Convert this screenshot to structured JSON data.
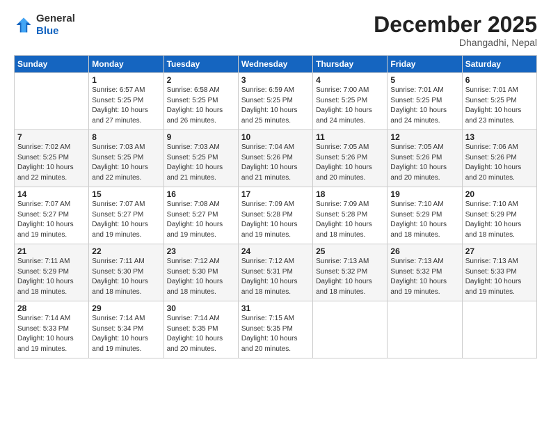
{
  "header": {
    "logo_general": "General",
    "logo_blue": "Blue",
    "month_title": "December 2025",
    "location": "Dhangadhi, Nepal"
  },
  "weekdays": [
    "Sunday",
    "Monday",
    "Tuesday",
    "Wednesday",
    "Thursday",
    "Friday",
    "Saturday"
  ],
  "weeks": [
    [
      {
        "day": "",
        "info": ""
      },
      {
        "day": "1",
        "info": "Sunrise: 6:57 AM\nSunset: 5:25 PM\nDaylight: 10 hours\nand 27 minutes."
      },
      {
        "day": "2",
        "info": "Sunrise: 6:58 AM\nSunset: 5:25 PM\nDaylight: 10 hours\nand 26 minutes."
      },
      {
        "day": "3",
        "info": "Sunrise: 6:59 AM\nSunset: 5:25 PM\nDaylight: 10 hours\nand 25 minutes."
      },
      {
        "day": "4",
        "info": "Sunrise: 7:00 AM\nSunset: 5:25 PM\nDaylight: 10 hours\nand 24 minutes."
      },
      {
        "day": "5",
        "info": "Sunrise: 7:01 AM\nSunset: 5:25 PM\nDaylight: 10 hours\nand 24 minutes."
      },
      {
        "day": "6",
        "info": "Sunrise: 7:01 AM\nSunset: 5:25 PM\nDaylight: 10 hours\nand 23 minutes."
      }
    ],
    [
      {
        "day": "7",
        "info": "Sunrise: 7:02 AM\nSunset: 5:25 PM\nDaylight: 10 hours\nand 22 minutes."
      },
      {
        "day": "8",
        "info": "Sunrise: 7:03 AM\nSunset: 5:25 PM\nDaylight: 10 hours\nand 22 minutes."
      },
      {
        "day": "9",
        "info": "Sunrise: 7:03 AM\nSunset: 5:25 PM\nDaylight: 10 hours\nand 21 minutes."
      },
      {
        "day": "10",
        "info": "Sunrise: 7:04 AM\nSunset: 5:26 PM\nDaylight: 10 hours\nand 21 minutes."
      },
      {
        "day": "11",
        "info": "Sunrise: 7:05 AM\nSunset: 5:26 PM\nDaylight: 10 hours\nand 20 minutes."
      },
      {
        "day": "12",
        "info": "Sunrise: 7:05 AM\nSunset: 5:26 PM\nDaylight: 10 hours\nand 20 minutes."
      },
      {
        "day": "13",
        "info": "Sunrise: 7:06 AM\nSunset: 5:26 PM\nDaylight: 10 hours\nand 20 minutes."
      }
    ],
    [
      {
        "day": "14",
        "info": "Sunrise: 7:07 AM\nSunset: 5:27 PM\nDaylight: 10 hours\nand 19 minutes."
      },
      {
        "day": "15",
        "info": "Sunrise: 7:07 AM\nSunset: 5:27 PM\nDaylight: 10 hours\nand 19 minutes."
      },
      {
        "day": "16",
        "info": "Sunrise: 7:08 AM\nSunset: 5:27 PM\nDaylight: 10 hours\nand 19 minutes."
      },
      {
        "day": "17",
        "info": "Sunrise: 7:09 AM\nSunset: 5:28 PM\nDaylight: 10 hours\nand 19 minutes."
      },
      {
        "day": "18",
        "info": "Sunrise: 7:09 AM\nSunset: 5:28 PM\nDaylight: 10 hours\nand 18 minutes."
      },
      {
        "day": "19",
        "info": "Sunrise: 7:10 AM\nSunset: 5:29 PM\nDaylight: 10 hours\nand 18 minutes."
      },
      {
        "day": "20",
        "info": "Sunrise: 7:10 AM\nSunset: 5:29 PM\nDaylight: 10 hours\nand 18 minutes."
      }
    ],
    [
      {
        "day": "21",
        "info": "Sunrise: 7:11 AM\nSunset: 5:29 PM\nDaylight: 10 hours\nand 18 minutes."
      },
      {
        "day": "22",
        "info": "Sunrise: 7:11 AM\nSunset: 5:30 PM\nDaylight: 10 hours\nand 18 minutes."
      },
      {
        "day": "23",
        "info": "Sunrise: 7:12 AM\nSunset: 5:30 PM\nDaylight: 10 hours\nand 18 minutes."
      },
      {
        "day": "24",
        "info": "Sunrise: 7:12 AM\nSunset: 5:31 PM\nDaylight: 10 hours\nand 18 minutes."
      },
      {
        "day": "25",
        "info": "Sunrise: 7:13 AM\nSunset: 5:32 PM\nDaylight: 10 hours\nand 18 minutes."
      },
      {
        "day": "26",
        "info": "Sunrise: 7:13 AM\nSunset: 5:32 PM\nDaylight: 10 hours\nand 19 minutes."
      },
      {
        "day": "27",
        "info": "Sunrise: 7:13 AM\nSunset: 5:33 PM\nDaylight: 10 hours\nand 19 minutes."
      }
    ],
    [
      {
        "day": "28",
        "info": "Sunrise: 7:14 AM\nSunset: 5:33 PM\nDaylight: 10 hours\nand 19 minutes."
      },
      {
        "day": "29",
        "info": "Sunrise: 7:14 AM\nSunset: 5:34 PM\nDaylight: 10 hours\nand 19 minutes."
      },
      {
        "day": "30",
        "info": "Sunrise: 7:14 AM\nSunset: 5:35 PM\nDaylight: 10 hours\nand 20 minutes."
      },
      {
        "day": "31",
        "info": "Sunrise: 7:15 AM\nSunset: 5:35 PM\nDaylight: 10 hours\nand 20 minutes."
      },
      {
        "day": "",
        "info": ""
      },
      {
        "day": "",
        "info": ""
      },
      {
        "day": "",
        "info": ""
      }
    ]
  ]
}
